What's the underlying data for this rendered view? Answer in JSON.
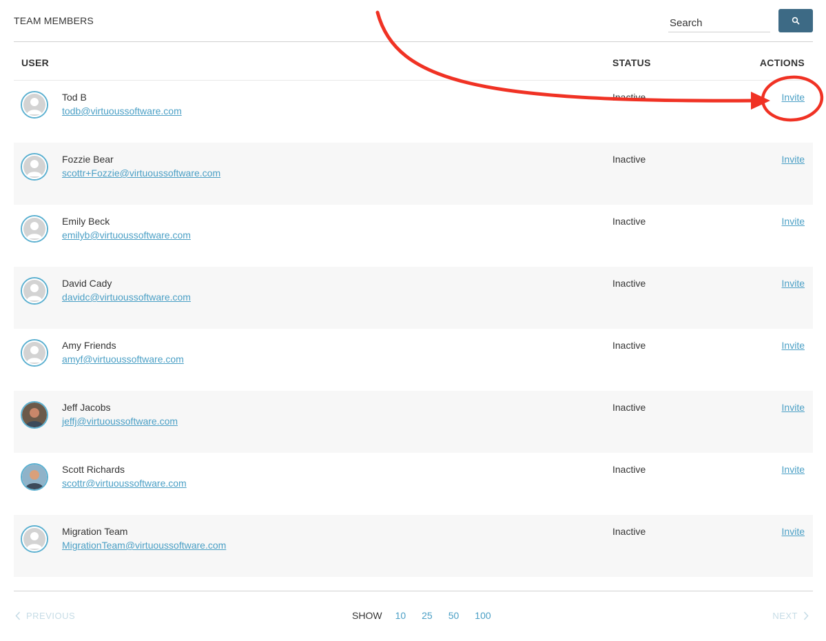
{
  "header": {
    "title": "TEAM MEMBERS",
    "search_placeholder": "Search",
    "search_icon": "search-icon"
  },
  "columns": {
    "user": "USER",
    "status": "STATUS",
    "actions": "ACTIONS"
  },
  "members": [
    {
      "name": "Tod B",
      "email": "todb@virtuoussoftware.com",
      "status": "Inactive",
      "action": "Invite",
      "avatar": "placeholder"
    },
    {
      "name": "Fozzie Bear",
      "email": "scottr+Fozzie@virtuoussoftware.com",
      "status": "Inactive",
      "action": "Invite",
      "avatar": "placeholder"
    },
    {
      "name": "Emily Beck",
      "email": "emilyb@virtuoussoftware.com",
      "status": "Inactive",
      "action": "Invite",
      "avatar": "placeholder"
    },
    {
      "name": "David Cady",
      "email": "davidc@virtuoussoftware.com",
      "status": "Inactive",
      "action": "Invite",
      "avatar": "placeholder"
    },
    {
      "name": "Amy Friends",
      "email": "amyf@virtuoussoftware.com",
      "status": "Inactive",
      "action": "Invite",
      "avatar": "placeholder"
    },
    {
      "name": "Jeff Jacobs",
      "email": "jeffj@virtuoussoftware.com",
      "status": "Inactive",
      "action": "Invite",
      "avatar": "photo"
    },
    {
      "name": "Scott Richards",
      "email": "scottr@virtuoussoftware.com",
      "status": "Inactive",
      "action": "Invite",
      "avatar": "photo"
    },
    {
      "name": "Migration Team",
      "email": "MigrationTeam@virtuoussoftware.com",
      "status": "Inactive",
      "action": "Invite",
      "avatar": "placeholder"
    }
  ],
  "pagination": {
    "previous": "PREVIOUS",
    "next": "NEXT",
    "show_label": "SHOW",
    "page_sizes": [
      "10",
      "25",
      "50",
      "100"
    ]
  },
  "colors": {
    "accent": "#4a9fc5",
    "button": "#3d6a85",
    "annotation": "#f03224"
  }
}
